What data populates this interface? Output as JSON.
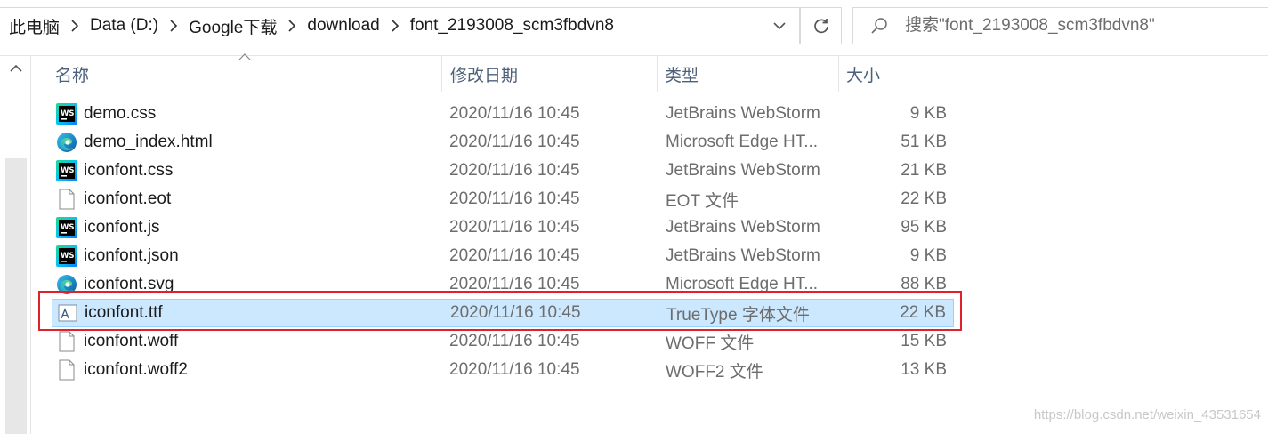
{
  "address_bar": {
    "breadcrumbs": [
      "此电脑",
      "Data (D:)",
      "Google下载",
      "download",
      "font_2193008_scm3fbdvn8"
    ]
  },
  "search": {
    "placeholder": "搜索\"font_2193008_scm3fbdvn8\""
  },
  "columns": {
    "name": "名称",
    "date": "修改日期",
    "type": "类型",
    "size": "大小"
  },
  "files": [
    {
      "name": "demo.css",
      "date": "2020/11/16 10:45",
      "type": "JetBrains WebStorm",
      "size": "9 KB",
      "icon": "webstorm-icon",
      "selected": false
    },
    {
      "name": "demo_index.html",
      "date": "2020/11/16 10:45",
      "type": "Microsoft Edge HT...",
      "size": "51 KB",
      "icon": "edge-icon",
      "selected": false
    },
    {
      "name": "iconfont.css",
      "date": "2020/11/16 10:45",
      "type": "JetBrains WebStorm",
      "size": "21 KB",
      "icon": "webstorm-icon",
      "selected": false
    },
    {
      "name": "iconfont.eot",
      "date": "2020/11/16 10:45",
      "type": "EOT 文件",
      "size": "22 KB",
      "icon": "blank-file-icon",
      "selected": false
    },
    {
      "name": "iconfont.js",
      "date": "2020/11/16 10:45",
      "type": "JetBrains WebStorm",
      "size": "95 KB",
      "icon": "webstorm-icon",
      "selected": false
    },
    {
      "name": "iconfont.json",
      "date": "2020/11/16 10:45",
      "type": "JetBrains WebStorm",
      "size": "9 KB",
      "icon": "webstorm-icon",
      "selected": false
    },
    {
      "name": "iconfont.svg",
      "date": "2020/11/16 10:45",
      "type": "Microsoft Edge HT...",
      "size": "88 KB",
      "icon": "edge-icon",
      "selected": false
    },
    {
      "name": "iconfont.ttf",
      "date": "2020/11/16 10:45",
      "type": "TrueType 字体文件",
      "size": "22 KB",
      "icon": "font-file-icon",
      "selected": true
    },
    {
      "name": "iconfont.woff",
      "date": "2020/11/16 10:45",
      "type": "WOFF 文件",
      "size": "15 KB",
      "icon": "blank-file-icon",
      "selected": false
    },
    {
      "name": "iconfont.woff2",
      "date": "2020/11/16 10:45",
      "type": "WOFF2 文件",
      "size": "13 KB",
      "icon": "blank-file-icon",
      "selected": false
    }
  ],
  "colors": {
    "selection_bg": "#cce8ff",
    "selection_border": "#99d1ff",
    "annotation": "#e0202a",
    "header_text": "#4c607a"
  },
  "watermark": "https://blog.csdn.net/weixin_43531654"
}
